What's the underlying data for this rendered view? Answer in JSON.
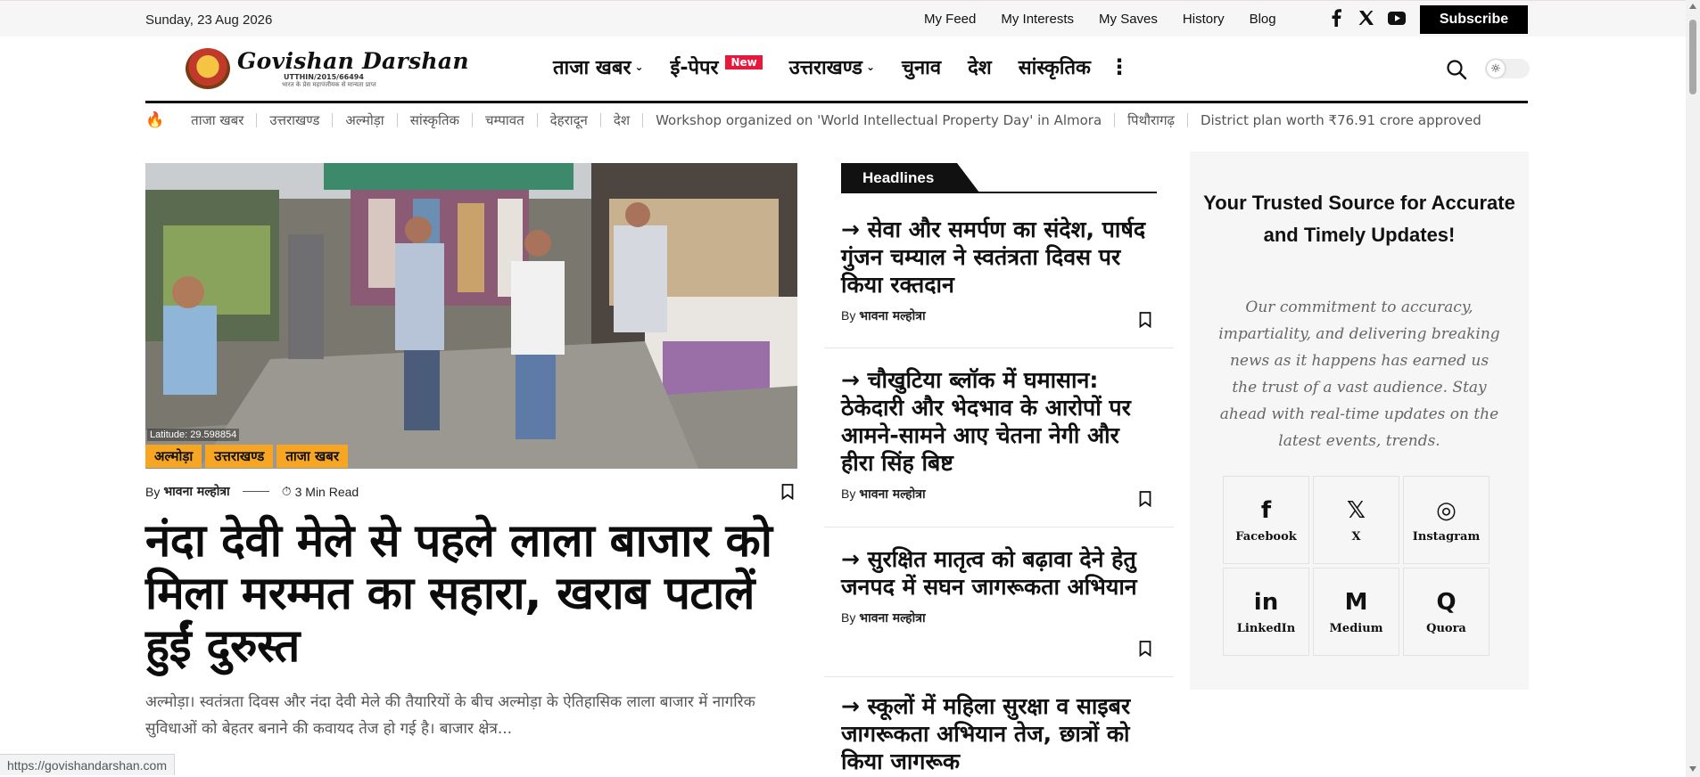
{
  "topbar": {
    "date": "Sunday, 23 Aug 2026",
    "links": [
      "My Feed",
      "My Interests",
      "My Saves",
      "History",
      "Blog"
    ],
    "subscribe_label": "Subscribe",
    "social_icons": [
      "facebook-icon",
      "x-icon",
      "youtube-icon"
    ]
  },
  "logo": {
    "title": "Govishan Darshan",
    "reg": "UTTHIN/2015/66494",
    "tagline": "भारत के प्रेस महापंजीयक से मान्यता प्राप्त"
  },
  "nav": {
    "items": [
      {
        "label": "ताजा खबर",
        "dropdown": true
      },
      {
        "label": "ई-पेपर",
        "badge": "New"
      },
      {
        "label": "उत्तराखण्ड",
        "dropdown": true
      },
      {
        "label": "चुनाव"
      },
      {
        "label": "देश"
      },
      {
        "label": "सांस्कृतिक"
      }
    ],
    "more_icon": "kebab-icon"
  },
  "ticker": {
    "items": [
      "ताजा खबर",
      "उत्तराखण्ड",
      "अल्मोड़ा",
      "सांस्कृतिक",
      "चम्पावत",
      "देहरादून",
      "देश",
      "Workshop organized on 'World Intellectual Property Day' in Almora",
      "पिथौरागढ़",
      "District plan worth ₹76.91 crore approved"
    ]
  },
  "hero": {
    "geotag": "Latitude: 29.598854",
    "categories": [
      "अल्मोड़ा",
      "उत्तराखण्ड",
      "ताजा खबर"
    ],
    "by_label": "By",
    "author": "भावना मल्होत्रा",
    "read_time": "3 Min Read",
    "title": "नंदा देवी मेले से पहले लाला बाजार को मिला मरम्मत का सहारा, खराब पटालें हुईं दुरुस्त",
    "excerpt": "अल्मोड़ा। स्वतंत्रता दिवस और नंदा देवी मेले की तैयारियों के बीच अल्मोड़ा के ऐतिहासिक लाला बाजार में नागरिक सुविधाओं को बेहतर बनाने की कवायद तेज हो गई है। बाजार क्षेत्र..."
  },
  "headlines": {
    "heading": "Headlines",
    "items": [
      {
        "title": "→ सेवा और समर्पण का संदेश, पार्षद गुंजन चम्याल ने स्वतंत्रता दिवस पर किया रक्तदान",
        "by": "By",
        "author": "भावना मल्होत्रा"
      },
      {
        "title": "→ चौखुटिया ब्लॉक में घमासान: ठेकेदारी और भेदभाव के आरोपों पर आमने-सामने आए चेतना नेगी और हीरा सिंह बिष्ट",
        "by": "By",
        "author": "भावना मल्होत्रा"
      },
      {
        "title": "→ सुरक्षित मातृत्व को बढ़ावा देने हेतु जनपद में सघन जागरूकता अभियान",
        "by": "By",
        "author": "भावना मल्होत्रा"
      },
      {
        "title": "→ स्कूलों में महिला सुरक्षा व साइबर जागरूकता अभियान तेज, छात्रों को किया जागरूक",
        "by": "",
        "author": ""
      }
    ]
  },
  "panel": {
    "title": "Your Trusted Source for Accurate and Timely Updates!",
    "text": "Our commitment to accuracy, impartiality, and delivering breaking news as it happens has earned us the trust of a vast audience. Stay ahead with real-time updates on the latest events, trends.",
    "socials": [
      {
        "label": "Facebook",
        "icon": "f"
      },
      {
        "label": "X",
        "icon": "𝕏"
      },
      {
        "label": "Instagram",
        "icon": "◎"
      },
      {
        "label": "LinkedIn",
        "icon": "in"
      },
      {
        "label": "Medium",
        "icon": "M"
      },
      {
        "label": "Quora",
        "icon": "Q"
      }
    ]
  },
  "status_url": "https://govishandarshan.com",
  "colors": {
    "accent_badge": "#e8173c",
    "category_tag": "#f6a623",
    "black": "#111111"
  }
}
